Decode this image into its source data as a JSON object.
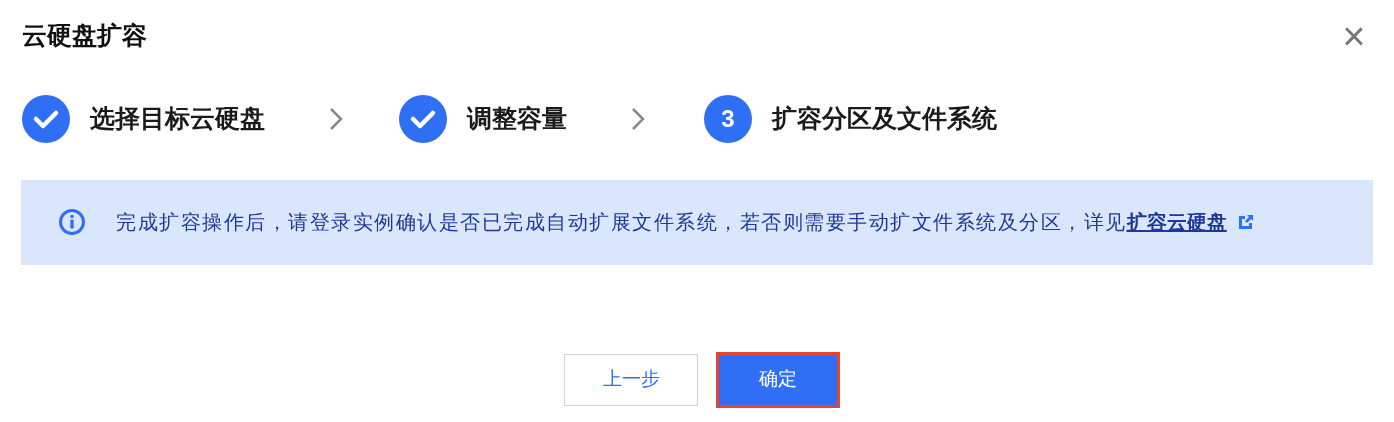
{
  "dialog": {
    "title": "云硬盘扩容",
    "close": "×"
  },
  "steps": [
    {
      "label": "选择目标云硬盘",
      "completed": true
    },
    {
      "label": "调整容量",
      "completed": true
    },
    {
      "label": "扩容分区及文件系统",
      "completed": false,
      "number": "3"
    }
  ],
  "notice": {
    "text": "完成扩容操作后，请登录实例确认是否已完成自动扩展文件系统，若否则需要手动扩文件系统及分区，详见",
    "link": "扩容云硬盘"
  },
  "buttons": [
    {
      "label": "上一步",
      "kind": "secondary",
      "highlighted": false
    },
    {
      "label": "确定",
      "kind": "primary",
      "highlighted": true
    }
  ]
}
